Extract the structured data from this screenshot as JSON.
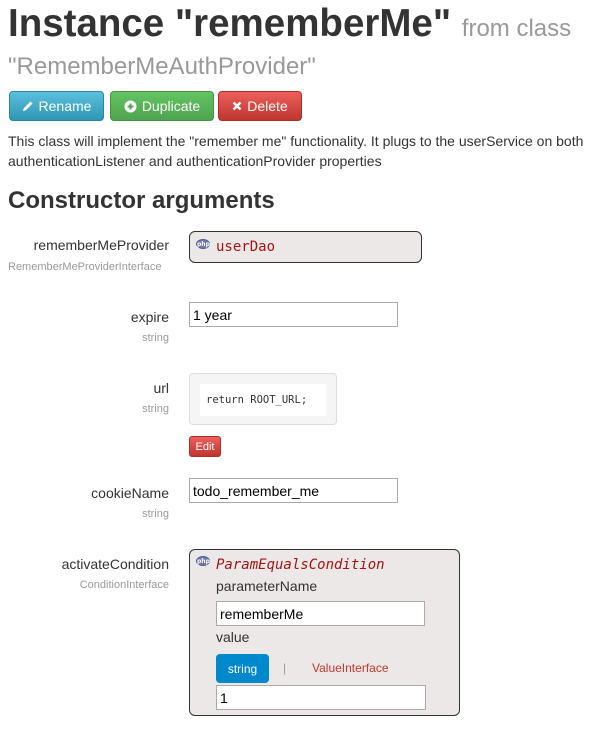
{
  "header": {
    "title": "Instance \"rememberMe\"",
    "title_suffix": "from class",
    "class_name": "\"RememberMeAuthProvider\""
  },
  "toolbar": {
    "rename_label": "Rename",
    "duplicate_label": "Duplicate",
    "delete_label": "Delete"
  },
  "description": "This class will implement the \"remember me\" functionality. It plugs to the userService on both authenticationListener and authenticationProvider properties",
  "section_title": "Constructor arguments",
  "arguments": {
    "rememberMeProvider": {
      "label": "rememberMeProvider",
      "type": "RememberMeProviderInterface",
      "value": "userDao"
    },
    "expire": {
      "label": "expire",
      "type": "string",
      "value": "1 year"
    },
    "url": {
      "label": "url",
      "type": "string",
      "code": "return ROOT_URL;",
      "edit_label": "Edit"
    },
    "cookieName": {
      "label": "cookieName",
      "type": "string",
      "value": "todo_remember_me"
    },
    "activateCondition": {
      "label": "activateCondition",
      "type": "ConditionInterface",
      "instance": "ParamEqualsCondition",
      "param_label": "parameterName",
      "param_value": "rememberMe",
      "value_label": "value",
      "tab_string": "string",
      "tab_separator": "|",
      "tab_interface": "ValueInterface",
      "value": "1"
    }
  },
  "icons": {
    "rename": "pencil-icon",
    "duplicate": "plus-circle-icon",
    "delete": "close-icon",
    "php": "php-icon"
  },
  "colors": {
    "rename": "#2f96b4",
    "duplicate": "#51a351",
    "delete": "#bd362f",
    "active_tab": "#0088cc",
    "code_red": "#a31515"
  }
}
